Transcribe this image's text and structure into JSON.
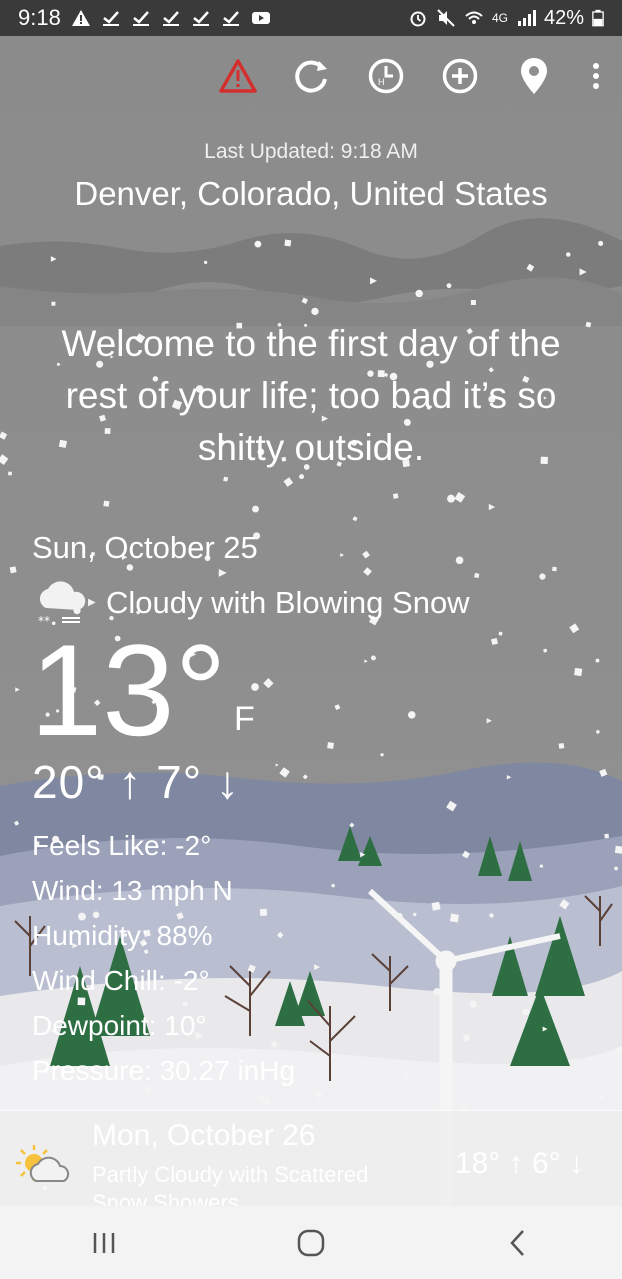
{
  "status_bar": {
    "time": "9:18",
    "network": "4G",
    "battery": "42%"
  },
  "actions": {
    "items": [
      "alert-icon",
      "refresh-icon",
      "history-icon",
      "add-location-icon",
      "location-pin-icon",
      "more-menu-icon"
    ]
  },
  "header": {
    "last_updated": "Last Updated: 9:18 AM",
    "location": "Denver, Colorado, United States"
  },
  "tagline": "Welcome to the first day of the rest of your life; too bad it’s so shitty outside.",
  "today": {
    "date": "Sun, October 25",
    "condition": "Cloudy with Blowing Snow",
    "temperature": "13°",
    "unit": "F",
    "hi_lo": "20° ↑ 7° ↓",
    "details": [
      "Feels Like: -2°",
      "Wind: 13 mph N",
      "Humidity: 88%",
      "Wind Chill: -2°",
      "Dewpoint: 10°",
      "Pressure: 30.27 inHg"
    ]
  },
  "forecast": {
    "date": "Mon, October 26",
    "condition": "Partly Cloudy with Scattered Snow Showers",
    "hi_lo": "18° ↑ 6° ↓"
  },
  "colors": {
    "alert": "#d32f2f",
    "sky_top": "#8c8c8c",
    "hills": "#7d86a3",
    "snow": "#e8e8ea",
    "tree_green": "#2d6b40"
  }
}
